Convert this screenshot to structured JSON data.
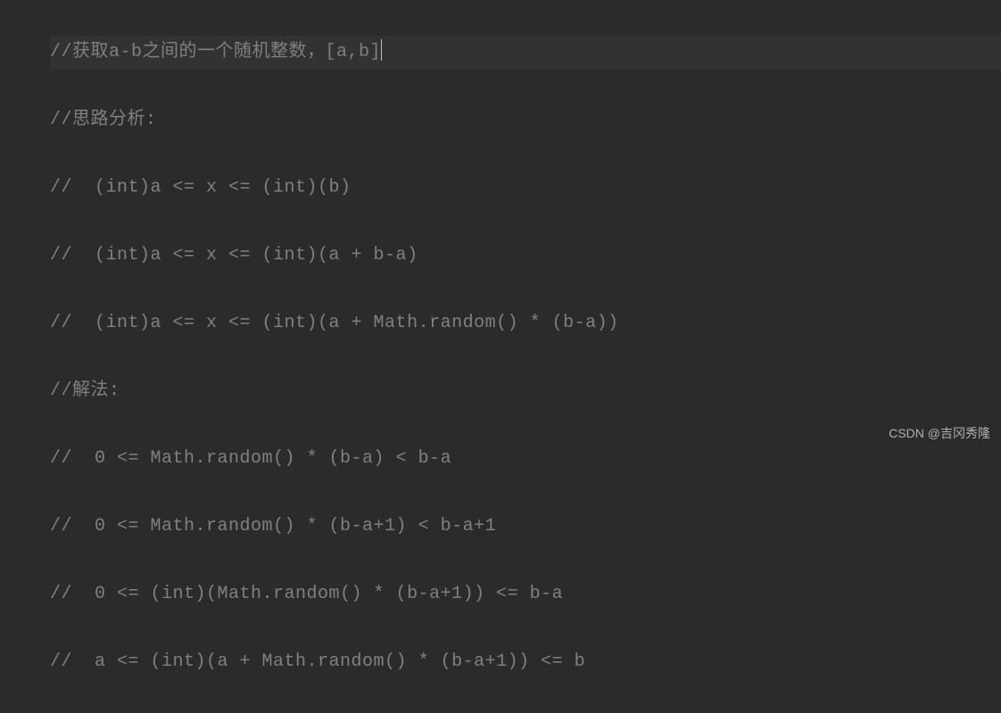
{
  "code": {
    "lines": [
      "//获取a-b之间的一个随机整数，[a,b]",
      "//思路分析:",
      "//  (int)a <= x <= (int)(b)",
      "//  (int)a <= x <= (int)(a + b-a)",
      "//  (int)a <= x <= (int)(a + Math.random() * (b-a))",
      "//解法:",
      "//  0 <= Math.random() * (b-a) < b-a",
      "//  0 <= Math.random() * (b-a+1) < b-a+1",
      "//  0 <= (int)(Math.random() * (b-a+1)) <= b-a",
      "//  a <= (int)(a + Math.random() * (b-a+1)) <= b"
    ]
  },
  "watermark": "CSDN @吉冈秀隆"
}
